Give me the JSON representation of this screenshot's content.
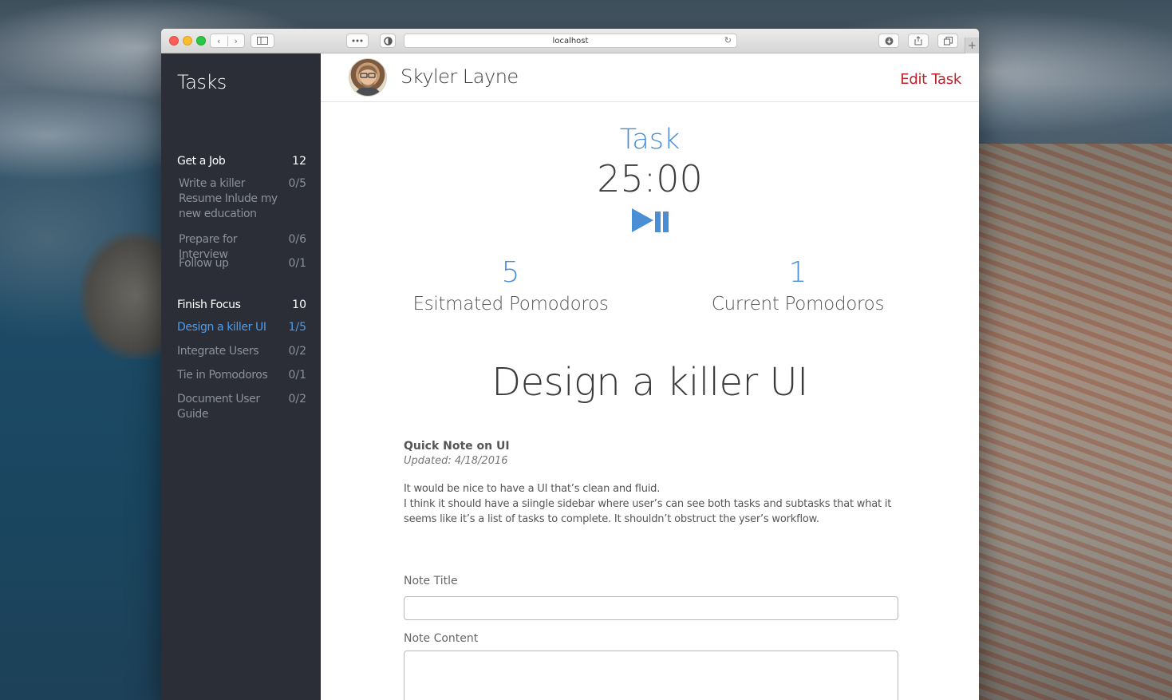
{
  "browser": {
    "url": "localhost",
    "back_glyph": "‹",
    "forward_glyph": "›",
    "new_tab_glyph": "+",
    "icons": [
      "sidebar-icon",
      "reader-dots-icon",
      "shield-icon",
      "reload-icon",
      "download-icon",
      "share-icon",
      "tabs-icon"
    ]
  },
  "sidebar": {
    "title": "Tasks",
    "groups": [
      {
        "label": "Get a Job",
        "count": "12",
        "items": [
          {
            "label": "Write a killer Resume Inlude my new education",
            "count": "0/5"
          },
          {
            "label": "Prepare for Interview",
            "count": "0/6"
          },
          {
            "label": "Follow up",
            "count": "0/1"
          }
        ]
      },
      {
        "label": "Finish Focus",
        "count": "10",
        "items": [
          {
            "label": "Design a killer UI",
            "count": "1/5",
            "active": true
          },
          {
            "label": "Integrate Users",
            "count": "0/2"
          },
          {
            "label": "Tie in Pomodoros",
            "count": "0/1"
          },
          {
            "label": "Document User Guide",
            "count": "0/2"
          }
        ]
      }
    ]
  },
  "header": {
    "user_name": "Skyler Layne",
    "edit_label": "Edit Task"
  },
  "timer": {
    "section_label": "Task",
    "time": "25:00"
  },
  "stats": {
    "estimated_value": "5",
    "estimated_label": "Esitmated Pomodoros",
    "current_value": "1",
    "current_label": "Current Pomodoros"
  },
  "task": {
    "name": "Design a killer UI"
  },
  "note": {
    "title": "Quick Note on UI",
    "updated": "Updated: 4/18/2016",
    "line1": "It would be nice to have a UI that’s clean and fluid.",
    "line2": "I think it should have a siingle sidebar where user’s can see both tasks and subtasks that what it seems like it’s a list of tasks to complete. It shouldn’t obstruct the yser’s workflow."
  },
  "form": {
    "title_label": "Note Title",
    "title_value": "",
    "content_label": "Note Content",
    "content_value": ""
  },
  "colors": {
    "accent": "#4a8fd6",
    "edit": "#c0202a",
    "sidebar_bg": "#2b2e36",
    "sidebar_active": "#4d9ded"
  }
}
